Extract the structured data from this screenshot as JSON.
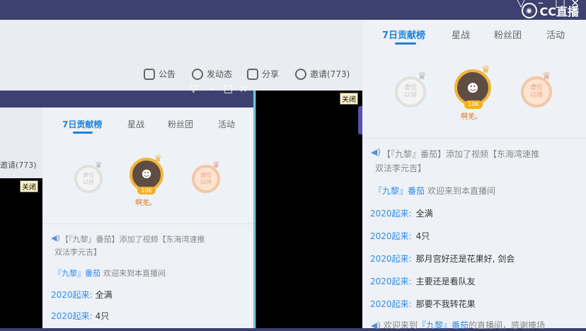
{
  "logo": {
    "text": "CC直播"
  },
  "actions": {
    "announce": "公告",
    "post": "发动态",
    "share": "分享",
    "invite": "邀请(773)"
  },
  "inner_invite": "邀请(773)",
  "close_label": "关闭",
  "tabs": [
    "7日贡献榜",
    "星战",
    "粉丝团",
    "活动"
  ],
  "ranking": {
    "seat_left": "虚位\n以待",
    "seat_right": "虚位\n以待",
    "top_badge": "10K",
    "top_name": "啊羌。"
  },
  "chat": {
    "system_line1": "【『九黎』番茄】添加了视频【东海湾速推",
    "system_line2": "双法李元吉】",
    "welcome_nick": "『九黎』番茄",
    "welcome_text": "欢迎来到本直播间",
    "messages": [
      {
        "nick": "2020起来:",
        "text": "全满"
      },
      {
        "nick": "2020起来:",
        "text": "4只"
      },
      {
        "nick": "2020起来:",
        "text": "那月宫好还是花果好, 剑会"
      },
      {
        "nick": "2020起来:",
        "text": "主要还是看队友"
      },
      {
        "nick": "2020起来:",
        "text": "那要不我转花果"
      }
    ],
    "bottom_prefix": "欢迎来到",
    "bottom_nick": "『九黎』番茄",
    "bottom_suffix": "的直播间，感谢捧场"
  },
  "colors": {
    "accent": "#1e82d8",
    "nick": "#2e8de6",
    "titlebar": "#3c416f"
  }
}
